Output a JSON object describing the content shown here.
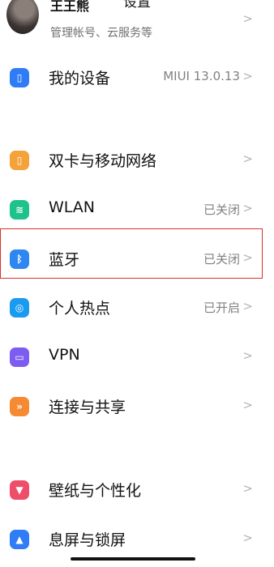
{
  "header": {
    "title": "设置"
  },
  "account": {
    "name": "王王熊",
    "subtitle": "管理帐号、云服务等",
    "chevron": ">"
  },
  "items": [
    {
      "label": "我的设备",
      "value": "MIUI 13.0.13",
      "chevron": ">",
      "icon": "device-icon",
      "icon_glyph": "▯",
      "color": "#2f7cf6"
    },
    {
      "label": "双卡与移动网络",
      "value": "",
      "chevron": ">",
      "icon": "sim-icon",
      "icon_glyph": "▯",
      "color": "#f4a23a"
    },
    {
      "label": "WLAN",
      "value": "已关闭",
      "chevron": ">",
      "icon": "wifi-icon",
      "icon_glyph": "≋",
      "color": "#1ec28b"
    },
    {
      "label": "蓝牙",
      "value": "已关闭",
      "chevron": ">",
      "icon": "bluetooth-icon",
      "icon_glyph": "ᛒ",
      "color": "#2e86f0"
    },
    {
      "label": "个人热点",
      "value": "已开启",
      "chevron": ">",
      "icon": "hotspot-icon",
      "icon_glyph": "◎",
      "color": "#1a9bf0"
    },
    {
      "label": "VPN",
      "value": "",
      "chevron": ">",
      "icon": "vpn-icon",
      "icon_glyph": "▭",
      "color": "#7d5cf2"
    },
    {
      "label": "连接与共享",
      "value": "",
      "chevron": ">",
      "icon": "share-icon",
      "icon_glyph": "»",
      "color": "#f68a33"
    },
    {
      "label": "壁纸与个性化",
      "value": "",
      "chevron": ">",
      "icon": "wallpaper-icon",
      "icon_glyph": "▼",
      "color": "#ef4e6a"
    },
    {
      "label": "息屏与锁屏",
      "value": "",
      "chevron": ">",
      "icon": "lock-icon",
      "icon_glyph": "▲",
      "color": "#2f7cf6"
    }
  ]
}
